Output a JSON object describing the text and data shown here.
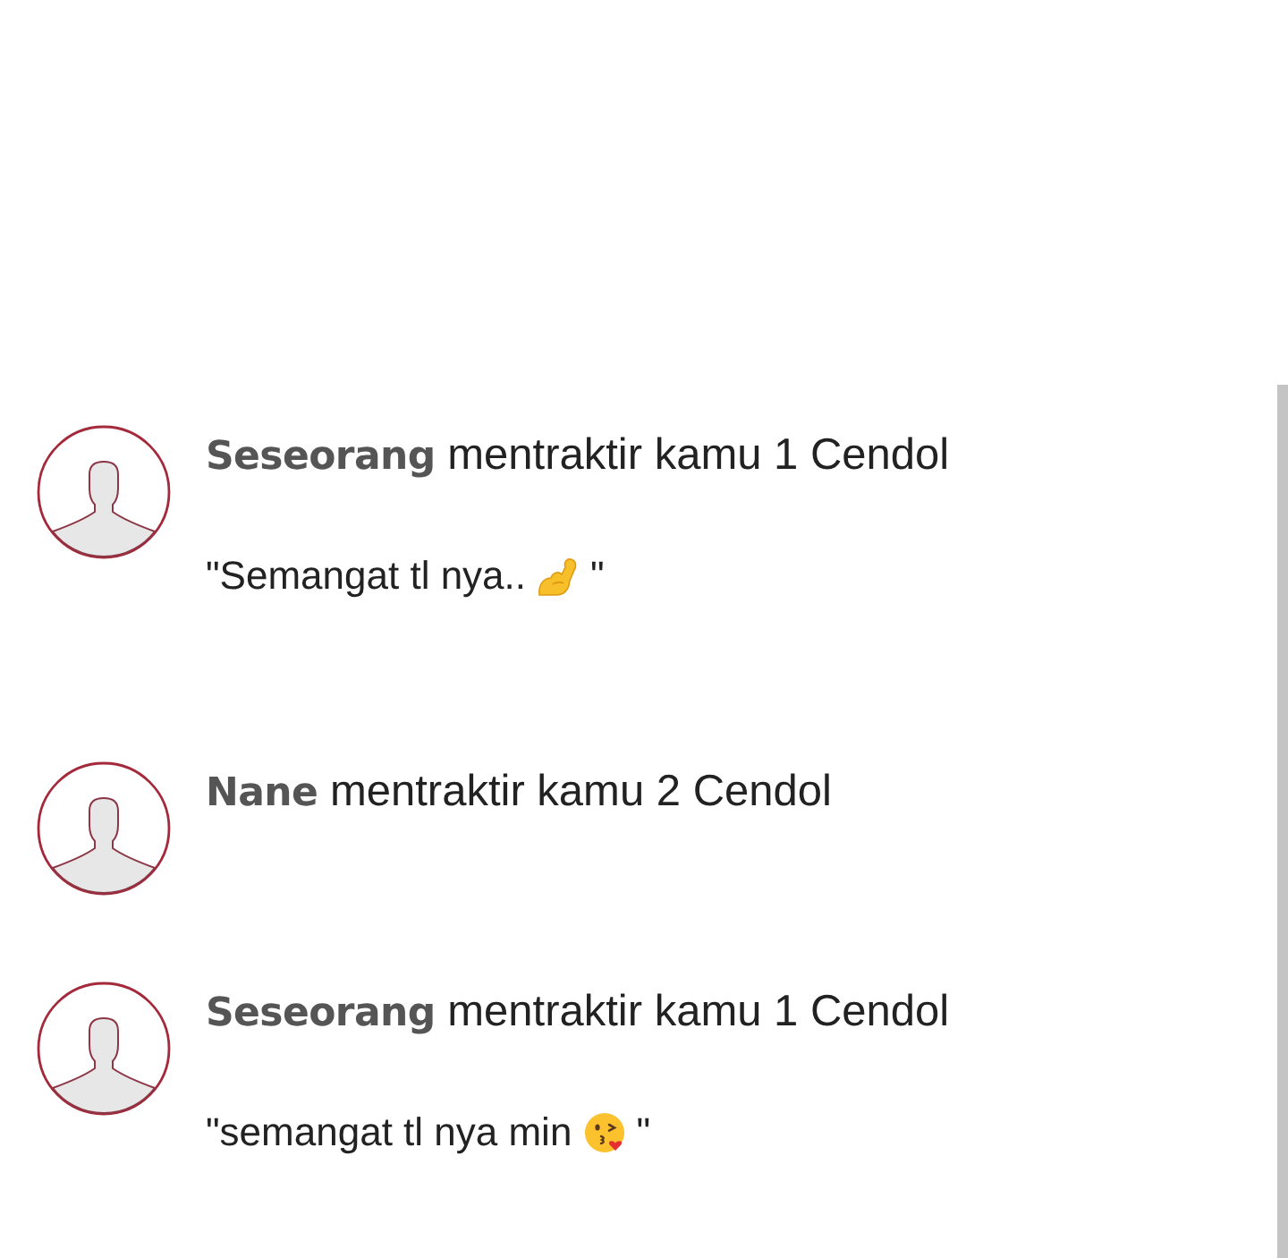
{
  "notifications": [
    {
      "title": "**Seseorang** mentraktir kamu 1 Cendol",
      "message": {
        "kind": "flex",
        "text": "\"Semangat tl nya..",
        "closing": "\""
      }
    },
    {
      "title": "**Nane** mentraktir kamu 2 Cendol"
    },
    {
      "title": "**Seseorang** mentraktir kamu 1 Cendol",
      "message": {
        "kind": "kiss",
        "text": "\"semangat tl nya min",
        "closing": "\""
      }
    }
  ]
}
